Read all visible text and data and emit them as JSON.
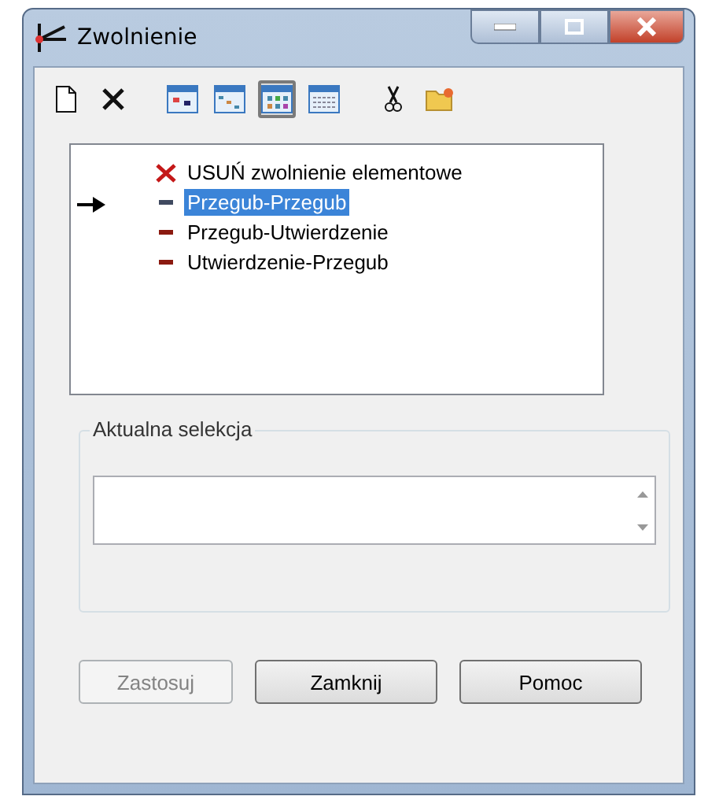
{
  "window": {
    "title": "Zwolnienie"
  },
  "toolbar": [
    {
      "kind": "new",
      "pressed": false
    },
    {
      "kind": "delete",
      "pressed": false
    },
    {
      "kind": "view1",
      "pressed": false
    },
    {
      "kind": "view2",
      "pressed": false
    },
    {
      "kind": "view3",
      "pressed": true
    },
    {
      "kind": "view4",
      "pressed": false
    },
    {
      "kind": "cut",
      "pressed": false
    },
    {
      "kind": "folder",
      "pressed": false
    }
  ],
  "list": [
    {
      "kind": "delete",
      "label": "USUŃ zwolnienie elementowe",
      "selected": false,
      "current": false
    },
    {
      "kind": "release",
      "label": "Przegub-Przegub",
      "selected": true,
      "current": true,
      "color": "#404a60"
    },
    {
      "kind": "release",
      "label": "Przegub-Utwierdzenie",
      "selected": false,
      "current": false,
      "color": "#8b1a10"
    },
    {
      "kind": "release",
      "label": "Utwierdzenie-Przegub",
      "selected": false,
      "current": false,
      "color": "#8b1a10"
    }
  ],
  "selection_group": {
    "title": "Aktualna selekcja"
  },
  "buttons": [
    {
      "label": "Zastosuj",
      "disabled": true
    },
    {
      "label": "Zamknij",
      "disabled": false
    },
    {
      "label": "Pomoc",
      "disabled": false
    }
  ]
}
